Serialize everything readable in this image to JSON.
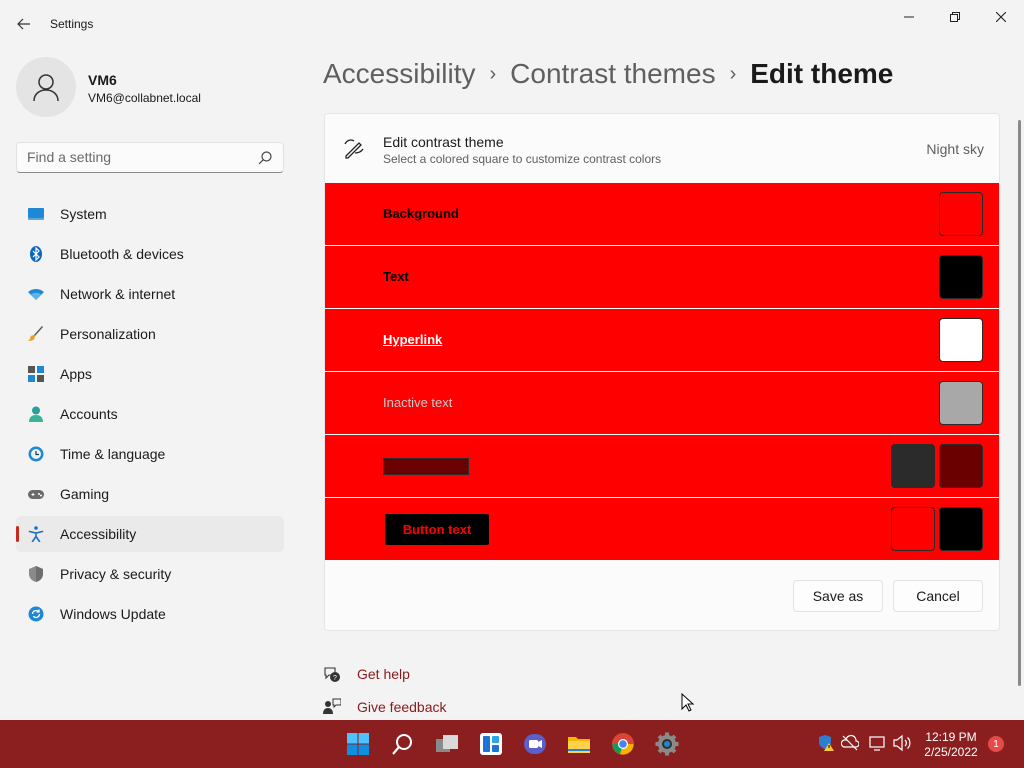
{
  "window": {
    "title": "Settings",
    "back_icon": "back-arrow-icon",
    "minimize_icon": "minimize-icon",
    "maximize_icon": "restore-icon",
    "close_icon": "close-icon"
  },
  "profile": {
    "name": "VM6",
    "email": "VM6@collabnet.local",
    "avatar_icon": "user-icon"
  },
  "search": {
    "placeholder": "Find a setting",
    "icon": "search-icon"
  },
  "sidebar": {
    "items": [
      {
        "label": "System",
        "icon": "system-icon",
        "active": false
      },
      {
        "label": "Bluetooth & devices",
        "icon": "bluetooth-icon",
        "active": false
      },
      {
        "label": "Network & internet",
        "icon": "wifi-icon",
        "active": false
      },
      {
        "label": "Personalization",
        "icon": "brush-icon",
        "active": false
      },
      {
        "label": "Apps",
        "icon": "apps-icon",
        "active": false
      },
      {
        "label": "Accounts",
        "icon": "accounts-icon",
        "active": false
      },
      {
        "label": "Time & language",
        "icon": "globe-clock-icon",
        "active": false
      },
      {
        "label": "Gaming",
        "icon": "gamepad-icon",
        "active": false
      },
      {
        "label": "Accessibility",
        "icon": "accessibility-icon",
        "active": true
      },
      {
        "label": "Privacy & security",
        "icon": "shield-icon",
        "active": false
      },
      {
        "label": "Windows Update",
        "icon": "update-icon",
        "active": false
      }
    ]
  },
  "breadcrumb": {
    "items": [
      "Accessibility",
      "Contrast themes"
    ],
    "current": "Edit theme",
    "separator": "›"
  },
  "panel": {
    "title": "Edit contrast theme",
    "subtitle": "Select a colored square to customize contrast colors",
    "theme_name": "Night sky",
    "icon": "edit-theme-icon",
    "rows": [
      {
        "label": "Background",
        "swatches": [
          "#ff0000"
        ]
      },
      {
        "label": "Text",
        "swatches": [
          "#000000"
        ]
      },
      {
        "label": "Hyperlink",
        "swatches": [
          "#ffffff"
        ]
      },
      {
        "label": "Inactive text",
        "swatches": [
          "#a8a8a8"
        ]
      },
      {
        "label": "",
        "swatches": [
          "#2b2b2b",
          "#6b0000"
        ]
      },
      {
        "label": "Button text",
        "swatches": [
          "#ff0000",
          "#000000"
        ]
      }
    ],
    "save_as_label": "Save as",
    "cancel_label": "Cancel"
  },
  "help": {
    "get_help": "Get help",
    "give_feedback": "Give feedback"
  },
  "taskbar": {
    "icons": [
      "windows-start-icon",
      "search-icon",
      "task-view-icon",
      "widgets-icon",
      "teams-chat-icon",
      "file-explorer-icon",
      "chrome-icon",
      "settings-icon"
    ],
    "tray_icons": [
      "security-warning-icon",
      "network-offline-icon",
      "display-icon",
      "volume-icon"
    ],
    "time": "12:19 PM",
    "date": "2/25/2022",
    "notification_count": "1"
  },
  "colors": {
    "accent": "#c42b1c",
    "row_background": "#ff0000",
    "taskbar": "#8b1f1f",
    "link": "#8b1a1a"
  }
}
